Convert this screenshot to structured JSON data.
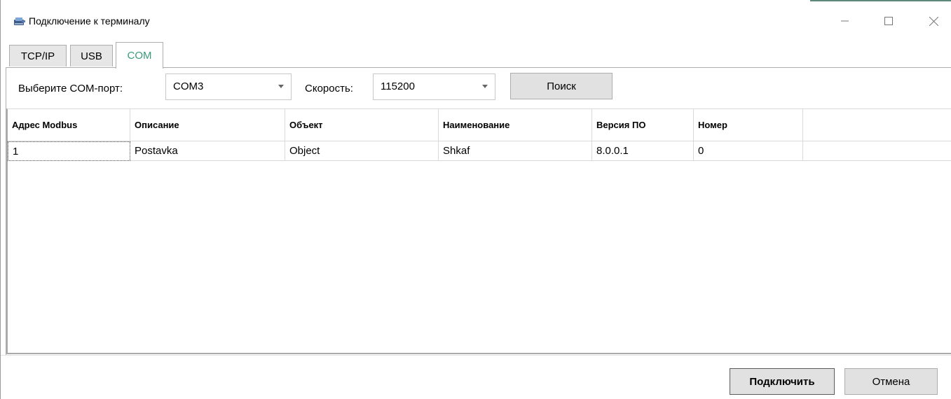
{
  "window": {
    "title": "Подключение к терминалу",
    "app_icon": "terminal-connection-icon",
    "controls": {
      "minimize": "minimize-icon",
      "maximize": "maximize-icon",
      "close": "close-icon"
    }
  },
  "tabs": [
    {
      "label": "TCP/IP",
      "active": false
    },
    {
      "label": "USB",
      "active": false
    },
    {
      "label": "COM",
      "active": true
    }
  ],
  "com_settings": {
    "port_label": "Выберите COM-порт:",
    "port_value": "COM3",
    "speed_label": "Скорость:",
    "speed_value": "115200",
    "search_button": "Поиск"
  },
  "grid": {
    "columns": [
      "Адрес Modbus",
      "Описание",
      "Объект",
      "Наименование",
      "Версия ПО",
      "Номер"
    ],
    "rows": [
      [
        "1",
        "Postavka",
        "Object",
        "Shkaf",
        "8.0.0.1",
        "0"
      ]
    ]
  },
  "footer": {
    "connect_button": "Подключить",
    "cancel_button": "Отмена"
  },
  "colors": {
    "active_tab_text": "#3a9a7a",
    "accent_line": "#5e8a7a"
  }
}
